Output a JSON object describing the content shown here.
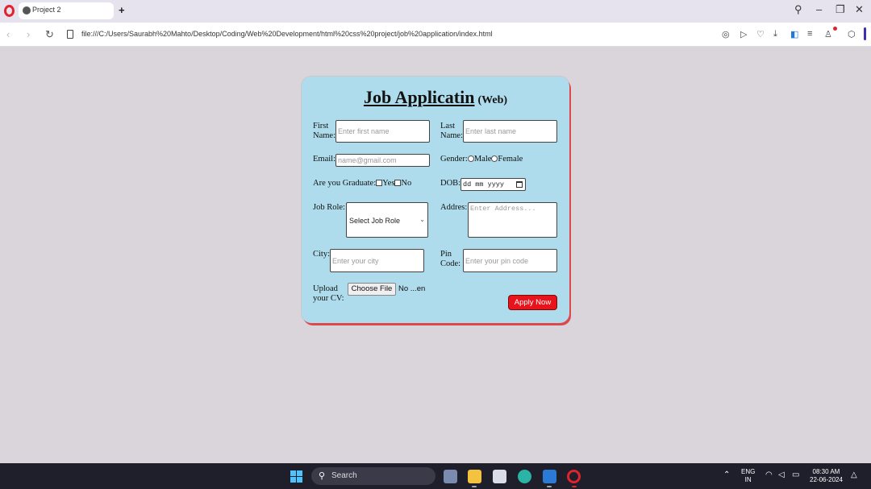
{
  "browser": {
    "tab_title": "Project 2",
    "new_tab_label": "+",
    "url": "file:///C:/Users/Saurabh%20Mahto/Desktop/Coding/Web%20Development/html%20css%20project/job%20application/index.html"
  },
  "form": {
    "title_main": "Job Applicatin",
    "title_sub": "(Web)",
    "first_name": {
      "label_1": "First",
      "label_2": "Name:",
      "placeholder": "Enter first name"
    },
    "last_name": {
      "label_1": "Last",
      "label_2": "Name:",
      "placeholder": "Enter last name"
    },
    "email": {
      "label": "Email:",
      "placeholder": "name@gmail.com"
    },
    "gender": {
      "label": "Gender:",
      "options": [
        "Male",
        "Female"
      ]
    },
    "graduate": {
      "label": "Are you Graduate:",
      "options": [
        "Yes",
        "No"
      ]
    },
    "dob": {
      "label": "DOB:",
      "placeholder": "dd mm yyyy"
    },
    "job_role": {
      "label": "Job Role:",
      "selected": "Select Job Role"
    },
    "address": {
      "label": "Addres:",
      "placeholder": "Enter Address..."
    },
    "city": {
      "label": "City:",
      "placeholder": "Enter your city"
    },
    "pin": {
      "label_1": "Pin",
      "label_2": "Code:",
      "placeholder": "Enter your pin code"
    },
    "cv": {
      "label_1": "Upload",
      "label_2": "your CV:",
      "button": "Choose File",
      "status": "No ...en"
    },
    "submit": "Apply Now"
  },
  "taskbar": {
    "search_label": "Search",
    "lang_1": "ENG",
    "lang_2": "IN",
    "time": "08:30 AM",
    "date": "22-06-2024"
  },
  "colors": {
    "card_bg": "#aedcec",
    "card_shadow": "#e0474c",
    "apply_bg": "#e8131b",
    "page_bg": "#d9d5da"
  }
}
